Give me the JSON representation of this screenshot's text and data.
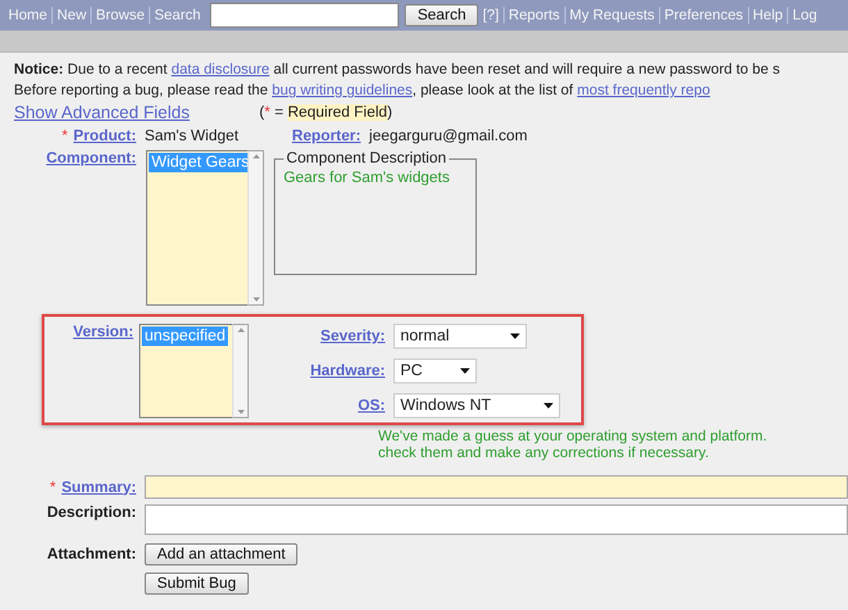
{
  "nav": {
    "links_before": [
      "Home",
      "New",
      "Browse",
      "Search"
    ],
    "search_button": "Search",
    "links_after": [
      "[?]",
      "Reports",
      "My Requests",
      "Preferences",
      "Help",
      "Log"
    ]
  },
  "notice": {
    "label": "Notice:",
    "before": "Due to a recent ",
    "link": "data disclosure",
    "after": " all current passwords have been reset and will require a new password to be s"
  },
  "guidelines": {
    "before": "Before reporting a bug, please read the ",
    "link1": "bug writing guidelines",
    "middle": ", please look at the list of ",
    "link2": "most frequently repo"
  },
  "advanced_link": "Show Advanced Fields",
  "required_note": {
    "open": "(",
    "star": "*",
    "equals": " = ",
    "text": "Required Field",
    "close": ")"
  },
  "product": {
    "label": "Product:",
    "required": true,
    "value": "Sam's Widget"
  },
  "reporter": {
    "label": "Reporter:",
    "value": "jeegarguru@gmail.com"
  },
  "component": {
    "label": "Component:",
    "options": [
      {
        "label": "Widget Gears",
        "selected": true
      }
    ],
    "description_title": "Component Description",
    "description": "Gears for Sam's widgets"
  },
  "version": {
    "label": "Version:",
    "options": [
      {
        "label": "unspecified",
        "selected": true
      }
    ]
  },
  "selects": [
    {
      "label": "Severity:",
      "value": "normal"
    },
    {
      "label": "Hardware:",
      "value": "PC"
    },
    {
      "label": "OS:",
      "value": "Windows NT"
    }
  ],
  "guess_note": [
    "We've made a guess at your operating system and platform.",
    "check them and make any corrections if necessary."
  ],
  "summary": {
    "label": "Summary:",
    "required": true
  },
  "description": {
    "label": "Description:"
  },
  "attachment": {
    "label": "Attachment:",
    "button": "Add an attachment"
  },
  "submit": "Submit Bug"
}
